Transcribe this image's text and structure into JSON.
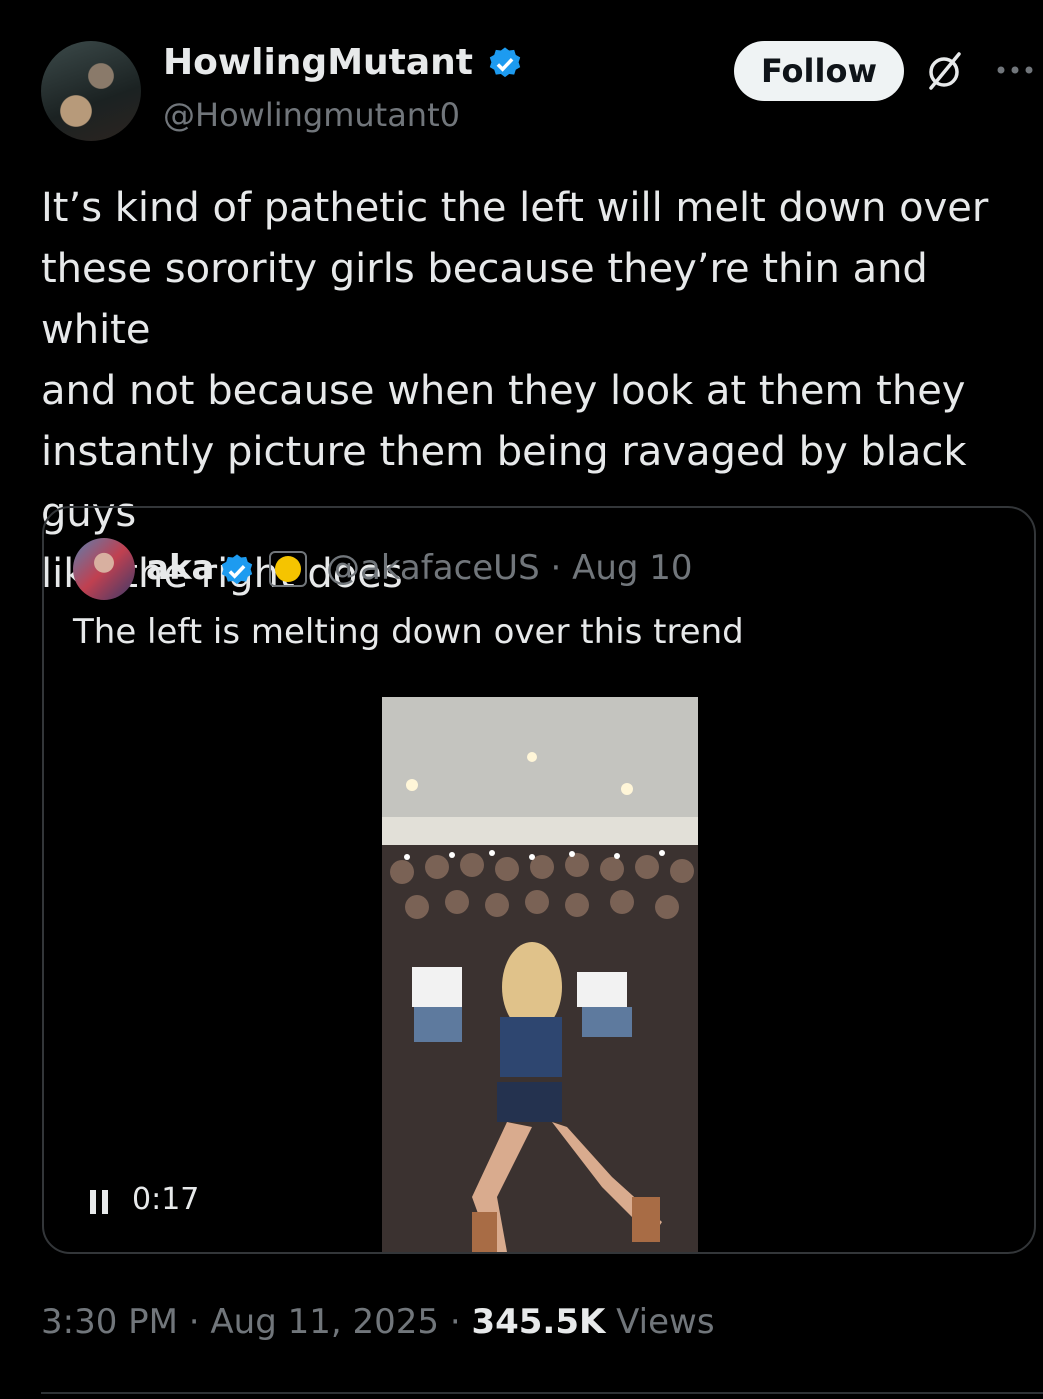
{
  "author": {
    "name": "HowlingMutant",
    "handle": "@Howlingmutant0"
  },
  "actions": {
    "follow_label": "Follow"
  },
  "tweet": {
    "text": "It’s kind of pathetic the left will melt down over\nthese sorority girls because they’re thin and white\nand not because when they look at them they\ninstantly picture them being ravaged by black guys\nlike the right does"
  },
  "quote": {
    "name": "aka",
    "meta": "@akafaceUS · Aug 10",
    "text": "The left is melting down over this trend",
    "video_duration": "0:17"
  },
  "footer": {
    "time": "3:30 PM · Aug 11, 2025 · ",
    "views_count": "345.5K",
    "views_label": " Views"
  },
  "colors": {
    "verified": "#1d9bf0",
    "muted_text": "#71767b",
    "border": "#333639"
  }
}
